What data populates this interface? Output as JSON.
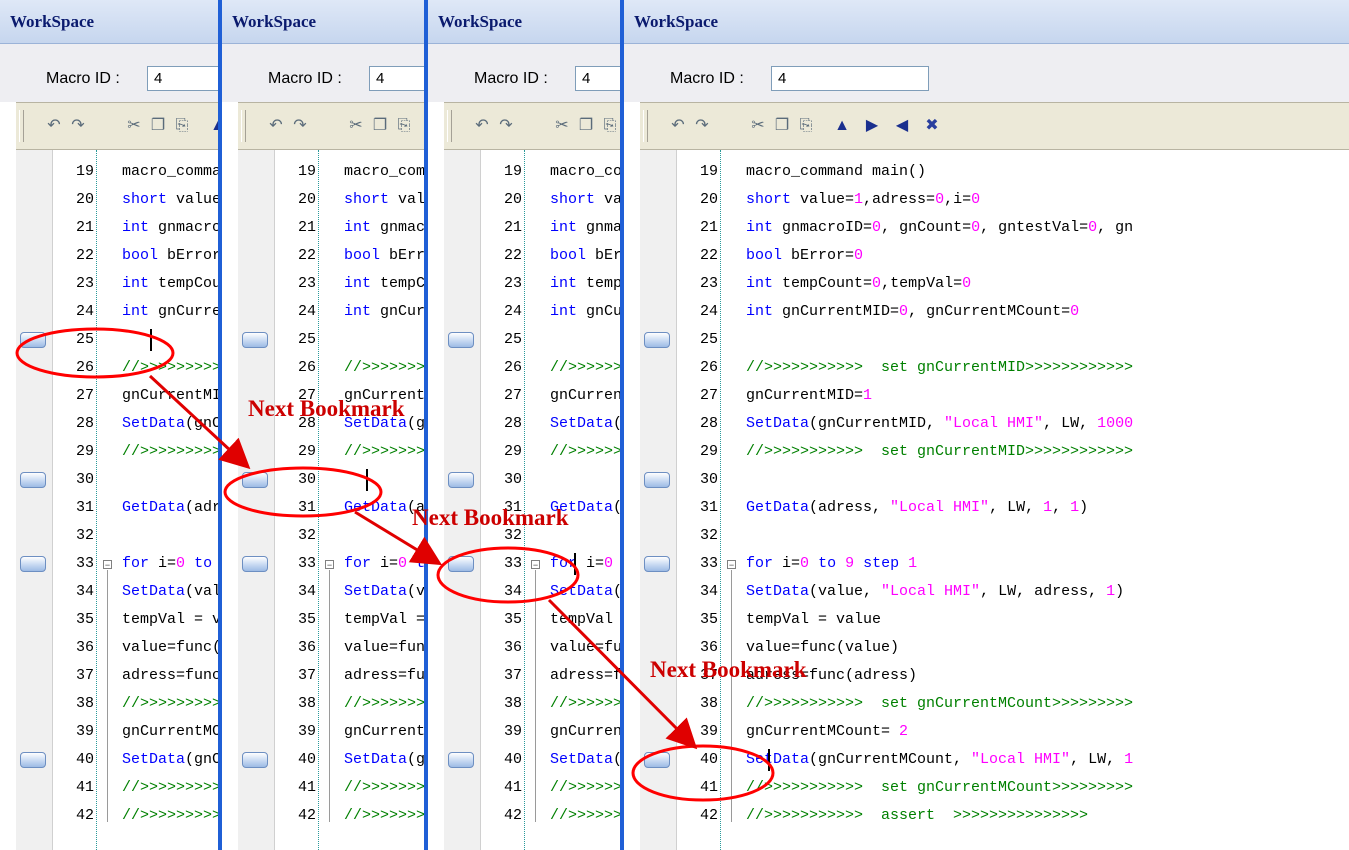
{
  "panels": [
    {
      "title": "WorkSpace",
      "macro_label": "Macro ID :",
      "macro_value": "4"
    },
    {
      "title": "WorkSpace",
      "macro_label": "Macro ID :",
      "macro_value": "4"
    },
    {
      "title": "WorkSpace",
      "macro_label": "Macro ID :",
      "macro_value": "4"
    },
    {
      "title": "WorkSpace",
      "macro_label": "Macro ID :",
      "macro_value": "4"
    }
  ],
  "toolbar_icons": [
    "undo-icon",
    "redo-icon",
    "cut-icon",
    "copy-icon",
    "paste-icon",
    "toggle-bookmark-icon",
    "next-bookmark-icon",
    "previous-bookmark-icon",
    "clear-bookmarks-icon"
  ],
  "lines": [
    {
      "n": "19",
      "bm": false,
      "segs": [
        [
          "t",
          "macro_command main()"
        ]
      ]
    },
    {
      "n": "20",
      "bm": false,
      "segs": [
        [
          "kw",
          "short"
        ],
        [
          "t",
          " value="
        ],
        [
          "num",
          "1"
        ],
        [
          "t",
          ",adress="
        ],
        [
          "num",
          "0"
        ],
        [
          "t",
          ",i="
        ],
        [
          "num",
          "0"
        ]
      ]
    },
    {
      "n": "21",
      "bm": false,
      "segs": [
        [
          "kw",
          "int"
        ],
        [
          "t",
          " gnmacroID="
        ],
        [
          "num",
          "0"
        ],
        [
          "t",
          ", gnCount="
        ],
        [
          "num",
          "0"
        ],
        [
          "t",
          ", gntestVal="
        ],
        [
          "num",
          "0"
        ],
        [
          "t",
          ", gn"
        ]
      ]
    },
    {
      "n": "22",
      "bm": false,
      "segs": [
        [
          "kw",
          "bool"
        ],
        [
          "t",
          " bError="
        ],
        [
          "num",
          "0"
        ]
      ]
    },
    {
      "n": "23",
      "bm": false,
      "segs": [
        [
          "kw",
          "int"
        ],
        [
          "t",
          " tempCount="
        ],
        [
          "num",
          "0"
        ],
        [
          "t",
          ",tempVal="
        ],
        [
          "num",
          "0"
        ]
      ]
    },
    {
      "n": "24",
      "bm": false,
      "segs": [
        [
          "kw",
          "int"
        ],
        [
          "t",
          " gnCurrentMID="
        ],
        [
          "num",
          "0"
        ],
        [
          "t",
          ", gnCurrentMCount="
        ],
        [
          "num",
          "0"
        ]
      ]
    },
    {
      "n": "25",
      "bm": true,
      "segs": []
    },
    {
      "n": "26",
      "bm": false,
      "segs": [
        [
          "cm",
          "//>>>>>>>>>>>  set gnCurrentMID>>>>>>>>>>>>"
        ]
      ]
    },
    {
      "n": "27",
      "bm": false,
      "segs": [
        [
          "t",
          "gnCurrentMID="
        ],
        [
          "num",
          "1"
        ]
      ]
    },
    {
      "n": "28",
      "bm": false,
      "segs": [
        [
          "kw",
          "SetData"
        ],
        [
          "t",
          "(gnCurrentMID, "
        ],
        [
          "str",
          "\"Local HMI\""
        ],
        [
          "t",
          ", LW, "
        ],
        [
          "num",
          "1000"
        ]
      ]
    },
    {
      "n": "29",
      "bm": false,
      "segs": [
        [
          "cm",
          "//>>>>>>>>>>>  set gnCurrentMID>>>>>>>>>>>>"
        ]
      ]
    },
    {
      "n": "30",
      "bm": true,
      "segs": []
    },
    {
      "n": "31",
      "bm": false,
      "segs": [
        [
          "kw",
          "GetData"
        ],
        [
          "t",
          "(adress, "
        ],
        [
          "str",
          "\"Local HMI\""
        ],
        [
          "t",
          ", LW, "
        ],
        [
          "num",
          "1"
        ],
        [
          "t",
          ", "
        ],
        [
          "num",
          "1"
        ],
        [
          "t",
          ")"
        ]
      ]
    },
    {
      "n": "32",
      "bm": false,
      "segs": []
    },
    {
      "n": "33",
      "bm": true,
      "fold": true,
      "segs": [
        [
          "kw",
          "for"
        ],
        [
          "t",
          " i="
        ],
        [
          "num",
          "0"
        ],
        [
          "t",
          " "
        ],
        [
          "kw",
          "to"
        ],
        [
          "t",
          " "
        ],
        [
          "num",
          "9"
        ],
        [
          "t",
          " "
        ],
        [
          "kw",
          "step"
        ],
        [
          "t",
          " "
        ],
        [
          "num",
          "1"
        ]
      ]
    },
    {
      "n": "34",
      "bm": false,
      "segs": [
        [
          "kw",
          "SetData"
        ],
        [
          "t",
          "(value, "
        ],
        [
          "str",
          "\"Local HMI\""
        ],
        [
          "t",
          ", LW, adress, "
        ],
        [
          "num",
          "1"
        ],
        [
          "t",
          ")"
        ]
      ]
    },
    {
      "n": "35",
      "bm": false,
      "segs": [
        [
          "t",
          "tempVal = value"
        ]
      ]
    },
    {
      "n": "36",
      "bm": false,
      "segs": [
        [
          "t",
          "value=func(value)"
        ]
      ]
    },
    {
      "n": "37",
      "bm": false,
      "segs": [
        [
          "t",
          "adress=func(adress)"
        ]
      ]
    },
    {
      "n": "38",
      "bm": false,
      "segs": [
        [
          "cm",
          "//>>>>>>>>>>>  set gnCurrentMCount>>>>>>>>>"
        ]
      ]
    },
    {
      "n": "39",
      "bm": false,
      "segs": [
        [
          "t",
          "gnCurrentMCount= "
        ],
        [
          "num",
          "2"
        ]
      ]
    },
    {
      "n": "40",
      "bm": true,
      "segs": [
        [
          "kw",
          "SetData"
        ],
        [
          "t",
          "(gnCurrentMCount, "
        ],
        [
          "str",
          "\"Local HMI\""
        ],
        [
          "t",
          ", LW, "
        ],
        [
          "num",
          "1"
        ]
      ]
    },
    {
      "n": "41",
      "bm": false,
      "segs": [
        [
          "cm",
          "//>>>>>>>>>>>  set gnCurrentMCount>>>>>>>>>"
        ]
      ]
    },
    {
      "n": "42",
      "bm": false,
      "segs": [
        [
          "cm",
          "//>>>>>>>>>>>  assert  >>>>>>>>>>>>>>>"
        ]
      ]
    }
  ],
  "annotations": [
    {
      "label": "Next Bookmark"
    },
    {
      "label": "Next Bookmark"
    },
    {
      "label": "Next Bookmark"
    }
  ],
  "colors": {
    "annotation": "#ff0000",
    "panel_border": "#1f5fd6",
    "keyword": "#0000ff",
    "number": "#ff00ff",
    "comment": "#008000"
  }
}
